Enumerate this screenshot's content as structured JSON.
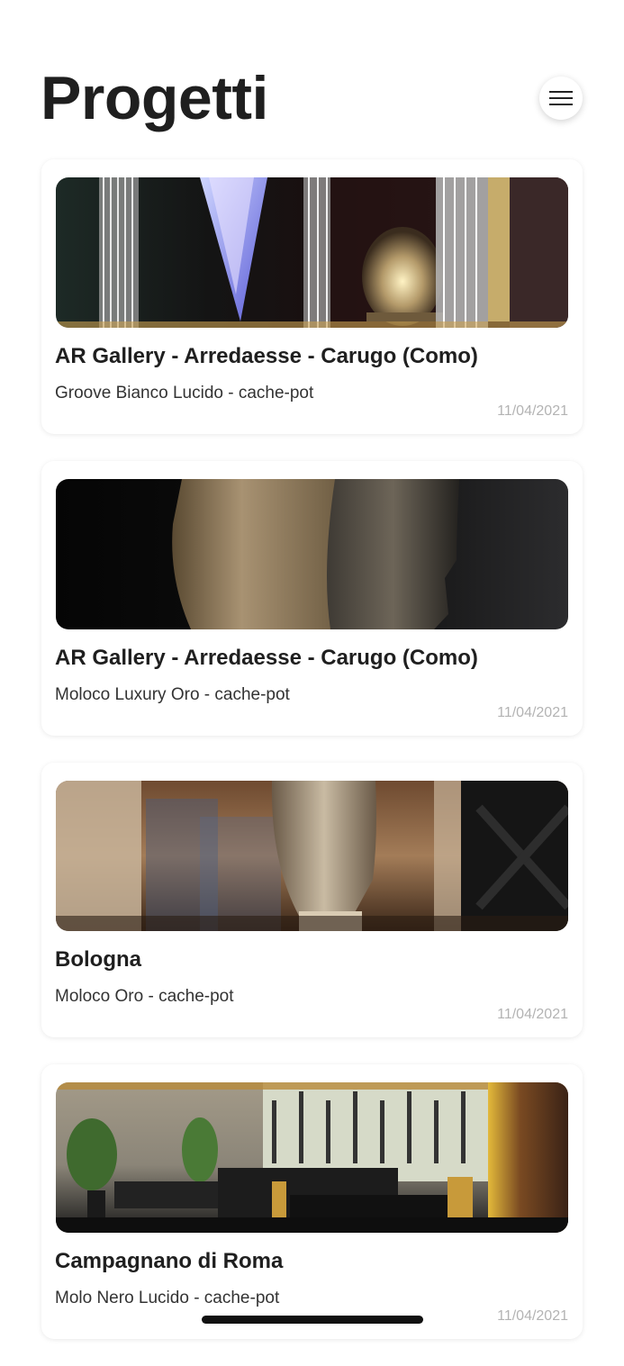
{
  "header": {
    "title": "Progetti",
    "menu_icon": "hamburger-menu-icon"
  },
  "projects": [
    {
      "title": "AR Gallery - Arredaesse - Carugo (Como)",
      "subtitle": "Groove Bianco Lucido - cache-pot",
      "date": "11/04/2021",
      "image": "showroom-curtains-armchair-photo"
    },
    {
      "title": "AR Gallery - Arredaesse - Carugo (Como)",
      "subtitle": "Moloco Luxury Oro - cache-pot",
      "date": "11/04/2021",
      "image": "two-head-sculptures-photo"
    },
    {
      "title": "Bologna",
      "subtitle": "Moloco Oro - cache-pot",
      "date": "11/04/2021",
      "image": "restaurant-head-sculpture-photo"
    },
    {
      "title": "Campagnano di Roma",
      "subtitle": "Molo Nero Lucido - cache-pot",
      "date": "11/04/2021",
      "image": "lounge-interior-photo"
    }
  ],
  "colors": {
    "text_primary": "#1f1f1f",
    "text_secondary": "#333333",
    "date": "#b3b3b3",
    "background": "#ffffff"
  }
}
